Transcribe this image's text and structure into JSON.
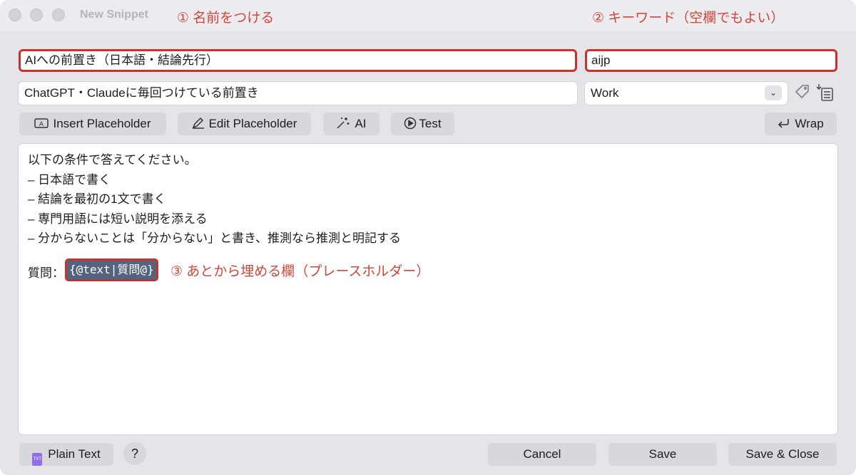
{
  "window": {
    "title": "New Snippet"
  },
  "annotations": {
    "name": "① 名前をつける",
    "keyword": "② キーワード（空欄でもよい）",
    "placeholder": "③ あとから埋める欄（プレースホルダー）"
  },
  "form": {
    "name": "AIへの前置き（日本語・結論先行）",
    "keyword": "aijp",
    "description": "ChatGPT・Claudeに毎回つけている前置き",
    "group": "Work"
  },
  "toolbar": {
    "insert_placeholder": "Insert Placeholder",
    "edit_placeholder": "Edit Placeholder",
    "ai": "AI",
    "test": "Test",
    "wrap": "Wrap"
  },
  "editor": {
    "lines": [
      "以下の条件で答えてください。",
      "–  日本語で書く",
      "–  結論を最初の1文で書く",
      "–  専門用語には短い説明を添える",
      "–  分からないことは「分からない」と書き、推測なら推測と明記する"
    ],
    "question_label": "質問：",
    "placeholder_token": "{@text|質問@}"
  },
  "footer": {
    "format": "Plain Text",
    "format_icon_text": "TXT",
    "help": "?",
    "cancel": "Cancel",
    "save": "Save",
    "save_close": "Save & Close"
  },
  "icons": {
    "tag": "tag-icon",
    "list": "list-icon",
    "insert_placeholder": "placeholder-icon",
    "edit_placeholder": "pencil-icon",
    "ai": "sparkles-icon",
    "test": "play-circle-icon",
    "wrap": "return-arrow-icon",
    "plain_text": "text-file-icon"
  },
  "colors": {
    "annotation": "#d0463b",
    "highlight_border": "#c6322f",
    "placeholder_bg": "#56637f"
  }
}
